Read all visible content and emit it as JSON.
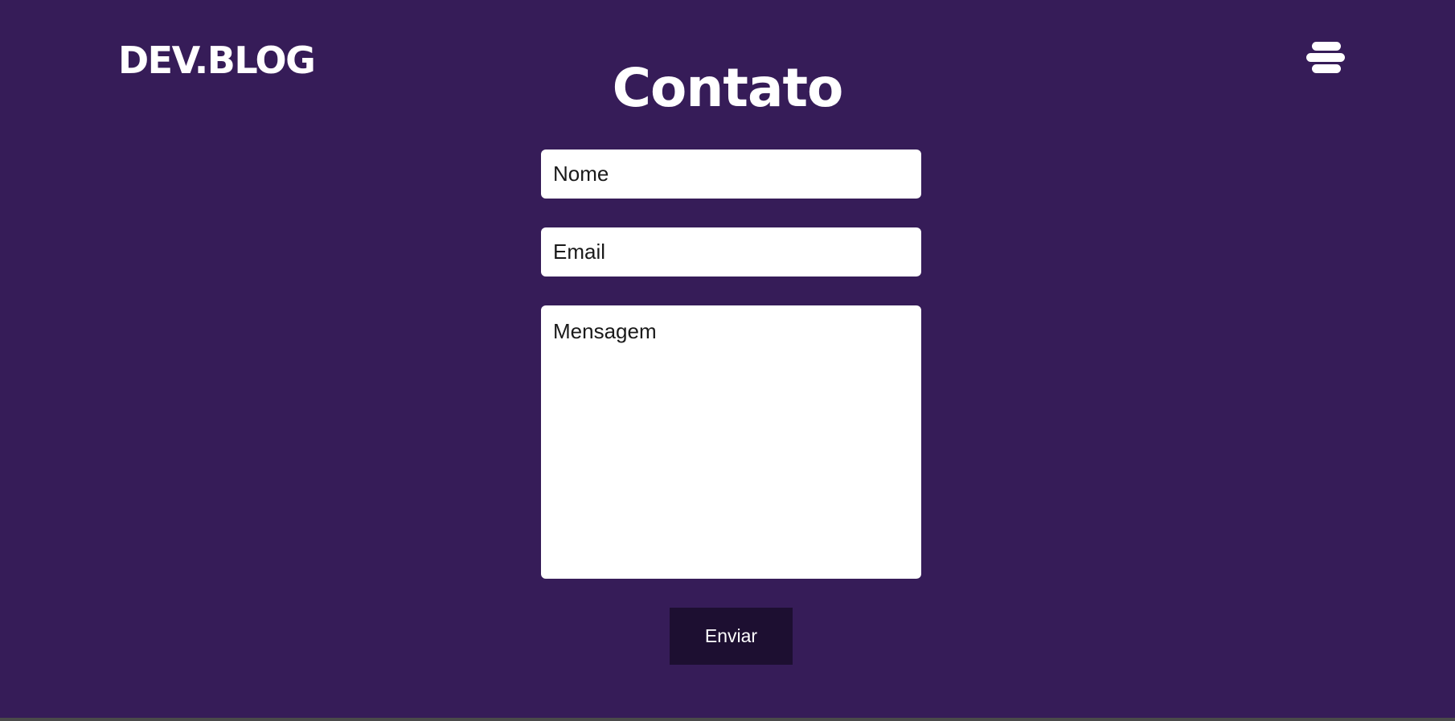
{
  "header": {
    "logo": "DEV.BLOG",
    "menu_icon": "hamburger-menu-icon"
  },
  "main": {
    "title": "Contato"
  },
  "form": {
    "name_placeholder": "Nome",
    "email_placeholder": "Email",
    "message_placeholder": "Mensagem",
    "submit_label": "Enviar"
  },
  "colors": {
    "background": "#361c58",
    "button": "#1d0f31",
    "text": "#ffffff"
  }
}
